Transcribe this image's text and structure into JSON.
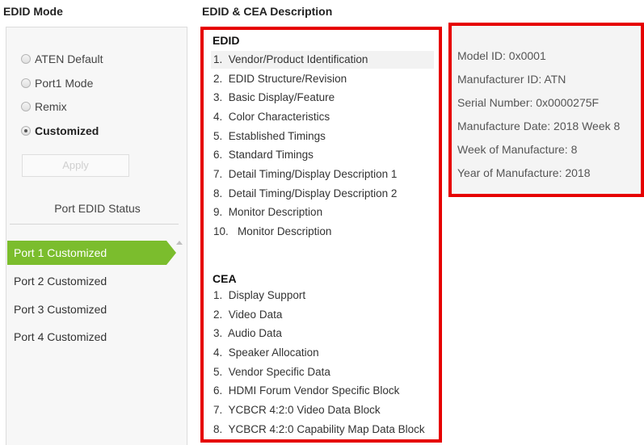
{
  "left": {
    "heading": "EDID Mode",
    "modes": [
      {
        "label": "ATEN Default",
        "checked": false
      },
      {
        "label": "Port1 Mode",
        "checked": false
      },
      {
        "label": "Remix",
        "checked": false
      },
      {
        "label": "Customized",
        "checked": true
      }
    ],
    "apply_label": "Apply",
    "status_label": "Port EDID Status",
    "ports": [
      {
        "label": "Port 1  Customized",
        "selected": true
      },
      {
        "label": "Port 2  Customized",
        "selected": false
      },
      {
        "label": "Port 3  Customized",
        "selected": false
      },
      {
        "label": "Port 4  Customized",
        "selected": false
      }
    ]
  },
  "middle": {
    "heading": "EDID & CEA Description",
    "edid_title": "EDID",
    "edid_items": [
      {
        "num": "1.",
        "label": "Vendor/Product Identification"
      },
      {
        "num": "2.",
        "label": "EDID Structure/Revision"
      },
      {
        "num": "3.",
        "label": "Basic Display/Feature"
      },
      {
        "num": "4.",
        "label": "Color Characteristics"
      },
      {
        "num": "5.",
        "label": "Established Timings"
      },
      {
        "num": "6.",
        "label": "Standard Timings"
      },
      {
        "num": "7.",
        "label": "Detail Timing/Display Description 1"
      },
      {
        "num": "8.",
        "label": "Detail Timing/Display Description 2"
      },
      {
        "num": "9.",
        "label": "Monitor Description"
      },
      {
        "num": "10.",
        "label": "Monitor Description"
      }
    ],
    "cea_title": "CEA",
    "cea_items": [
      {
        "num": "1.",
        "label": "Display Support"
      },
      {
        "num": "2.",
        "label": "Video Data"
      },
      {
        "num": "3.",
        "label": "Audio Data"
      },
      {
        "num": "4.",
        "label": "Speaker Allocation"
      },
      {
        "num": "5.",
        "label": "Vendor Specific Data"
      },
      {
        "num": "6.",
        "label": "HDMI Forum Vendor Specific Block"
      },
      {
        "num": "7.",
        "label": "YCBCR 4:2:0 Video Data Block"
      },
      {
        "num": "8.",
        "label": "YCBCR 4:2:0 Capability Map Data Block"
      }
    ]
  },
  "right": {
    "lines": [
      "Model ID: 0x0001",
      "Manufacturer ID: ATN",
      "Serial Number: 0x0000275F",
      "Manufacture Date: 2018 Week 8",
      "Week of Manufacture: 8",
      "Year of Manufacture: 2018"
    ]
  },
  "colors": {
    "highlight_border": "#e60000",
    "selected_port": "#7bbd2d"
  }
}
